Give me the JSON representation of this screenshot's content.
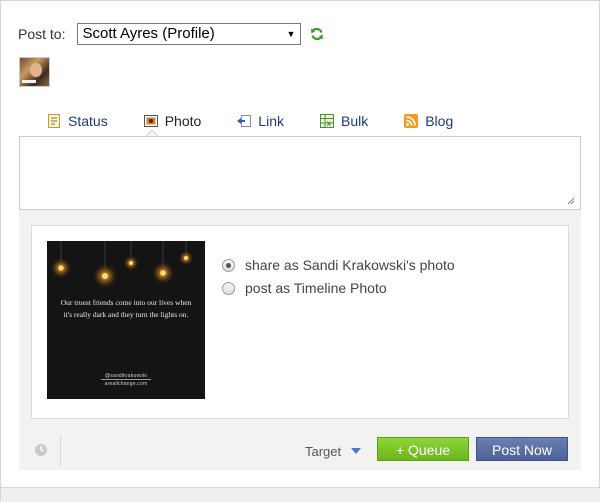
{
  "composer": {
    "post_to_label": "Post to:",
    "selected_profile": "Scott Ayres (Profile)"
  },
  "tabs": [
    {
      "label": "Status",
      "icon": "document-icon"
    },
    {
      "label": "Photo",
      "icon": "photo-icon",
      "active": true
    },
    {
      "label": "Link",
      "icon": "link-icon"
    },
    {
      "label": "Bulk",
      "icon": "spreadsheet-icon"
    },
    {
      "label": "Blog",
      "icon": "rss-icon"
    }
  ],
  "message": {
    "value": "",
    "placeholder": ""
  },
  "attachment": {
    "quote": "Our truest friends come into our lives when it's really dark and they turn the lights on.",
    "credit_handle": "@sandikrakowski",
    "credit_site": "areallchange.com",
    "share_options": [
      {
        "label": "share as Sandi Krakowski's photo",
        "selected": true
      },
      {
        "label": "post as Timeline Photo",
        "selected": false
      }
    ]
  },
  "actions": {
    "target_label": "Target",
    "queue_label": "+ Queue",
    "post_now_label": "Post Now"
  },
  "colors": {
    "link_blue": "#1d3a78",
    "queue_green": "#7cc52a",
    "post_now_blue": "#5a6fa6",
    "panel_gray": "#f2f2f2"
  }
}
